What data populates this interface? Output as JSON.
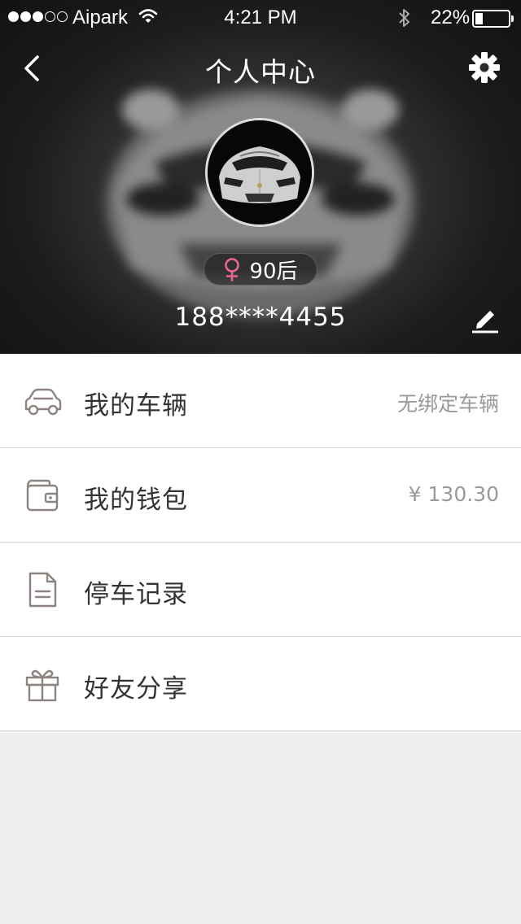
{
  "status_bar": {
    "carrier": "Aipark",
    "time": "4:21 PM",
    "battery_percent": "22%",
    "battery_level": 0.22,
    "signal_bars_filled": 3,
    "signal_bars_total": 5
  },
  "nav": {
    "title": "个人中心",
    "back_icon": "chevron-left-icon",
    "settings_icon": "gear-icon"
  },
  "profile": {
    "avatar_icon": "car-avatar-image",
    "gender_icon": "female-icon",
    "gender_color": "#e8678f",
    "age_tag": "90后",
    "phone": "188****4455",
    "edit_icon": "pencil-icon"
  },
  "menu": {
    "items": [
      {
        "label": "我的车辆",
        "value": "无绑定车辆",
        "icon": "car-icon"
      },
      {
        "label": "我的钱包",
        "value": "¥ 130.30",
        "icon": "wallet-icon"
      },
      {
        "label": "停车记录",
        "value": "",
        "icon": "document-icon"
      },
      {
        "label": "好友分享",
        "value": "",
        "icon": "gift-icon"
      }
    ]
  },
  "colors": {
    "icon_gray": "#8d8480",
    "text_dark": "#333333",
    "text_light": "#9a9a9a",
    "page_bg": "#efefef"
  }
}
